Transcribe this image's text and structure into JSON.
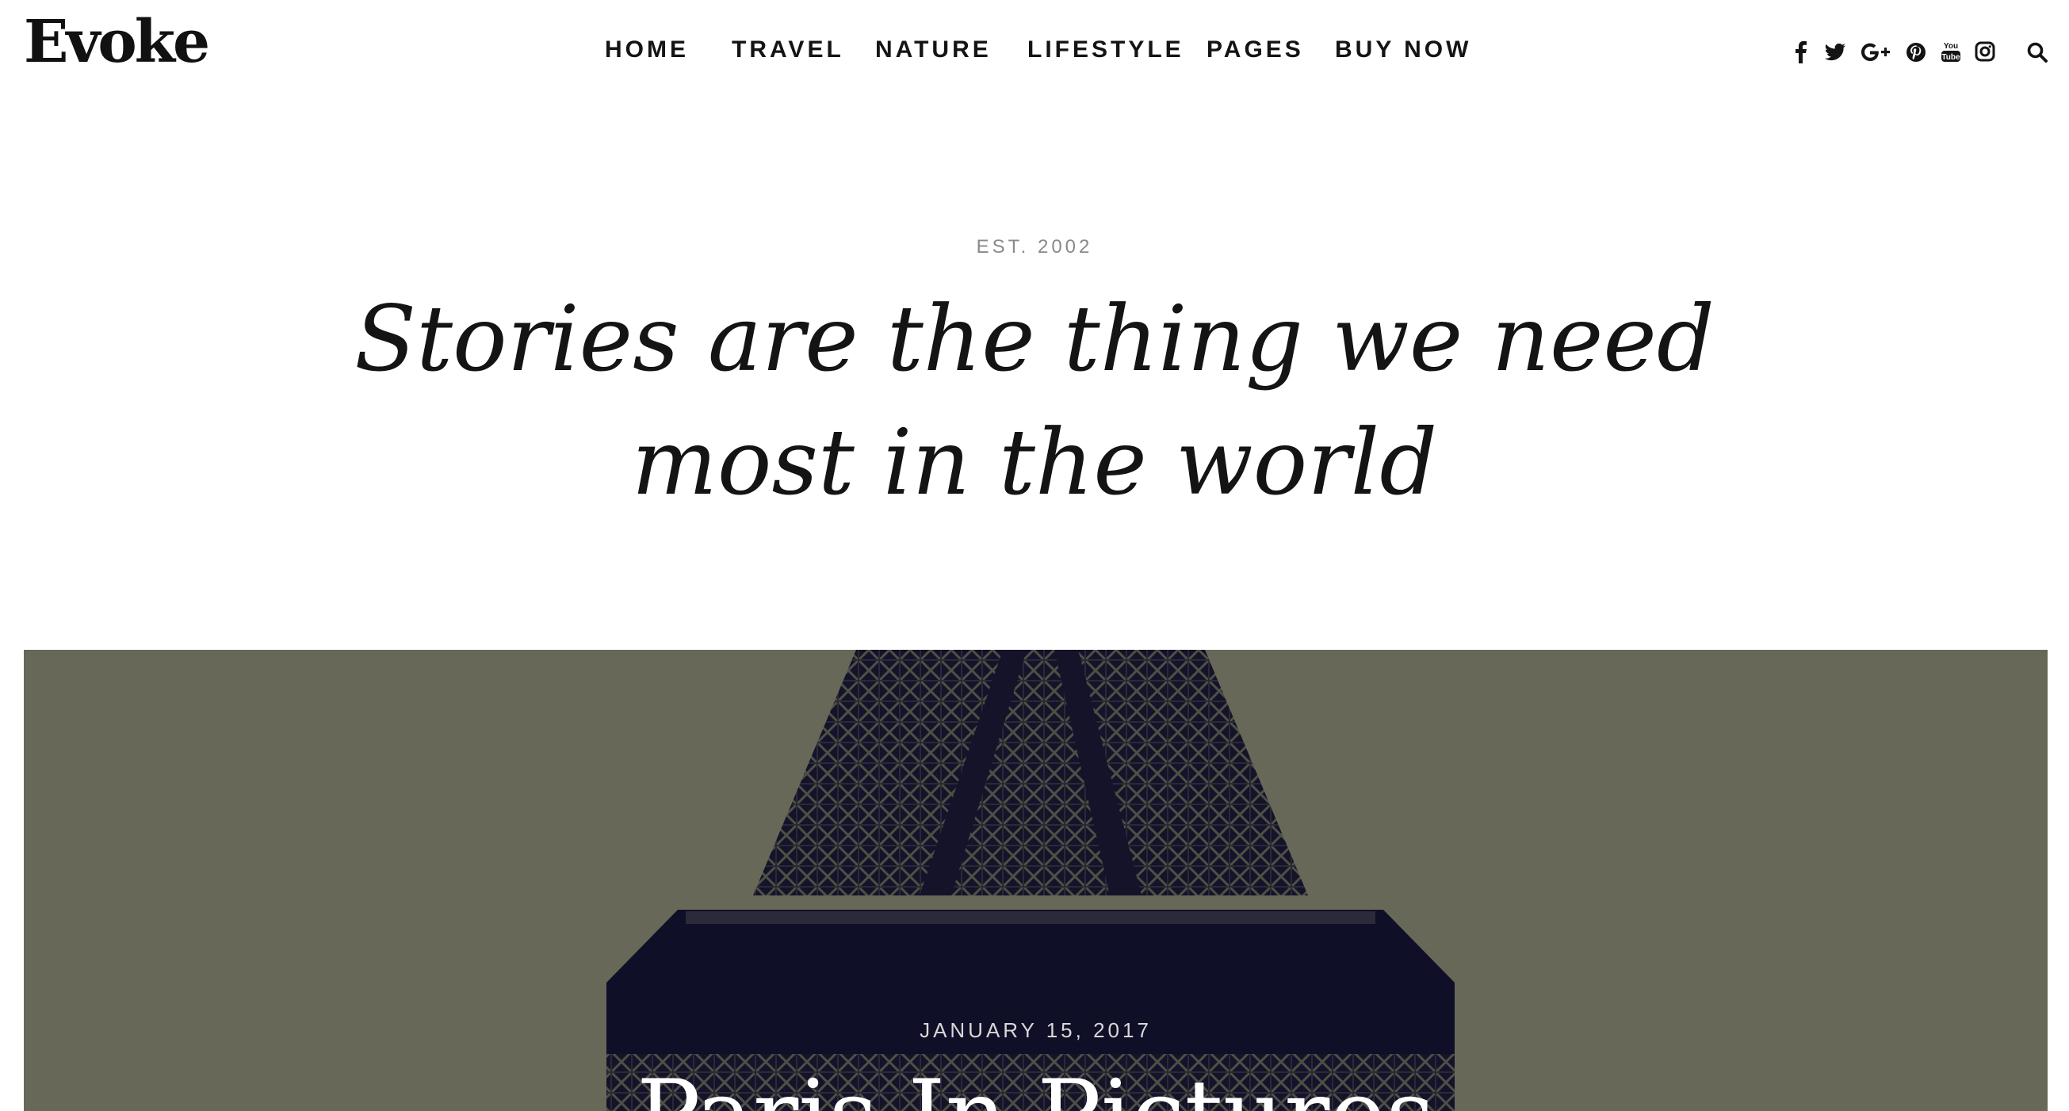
{
  "header": {
    "logo": "Evoke",
    "nav": [
      {
        "label": "HOME"
      },
      {
        "label": "TRAVEL"
      },
      {
        "label": "NATURE"
      },
      {
        "label": "LIFESTYLE"
      },
      {
        "label": "PAGES"
      },
      {
        "label": "BUY NOW"
      }
    ],
    "social_icons": [
      "facebook-icon",
      "twitter-icon",
      "google-plus-icon",
      "pinterest-icon",
      "youtube-icon",
      "instagram-icon"
    ],
    "search_icon": "search-icon"
  },
  "intro": {
    "eyebrow": "EST. 2002",
    "tagline": "Stories are the thing we need most in the world"
  },
  "featured_post": {
    "date": "JANUARY 15, 2017",
    "title": "Paris In Pictures"
  },
  "colors": {
    "text": "#141414",
    "muted": "#8a8a8a",
    "hero_bg": "#686859",
    "tower": "#14132a"
  }
}
